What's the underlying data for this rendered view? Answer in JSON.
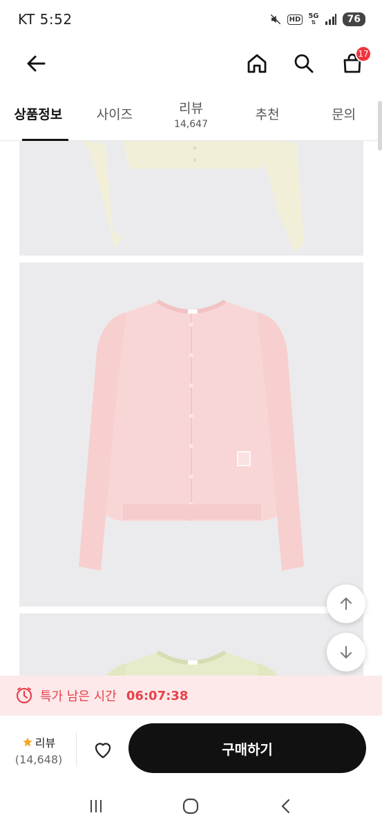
{
  "status_bar": {
    "time": "KT 5:52",
    "hd": "HD",
    "network": "5G",
    "battery": "76"
  },
  "app_bar": {
    "icons": [
      "back-arrow-icon",
      "home-icon",
      "search-icon",
      "shopping-bag-icon"
    ],
    "cart_count": "17"
  },
  "tabs": [
    {
      "label": "상품정보",
      "count": "",
      "active": true
    },
    {
      "label": "사이즈",
      "count": ""
    },
    {
      "label": "리뷰",
      "count": "14,647"
    },
    {
      "label": "추천",
      "count": ""
    },
    {
      "label": "문의",
      "count": ""
    }
  ],
  "product_images": [
    {
      "description": "cream-cardigan",
      "color": "#f2efd9"
    },
    {
      "description": "pink-cardigan",
      "color": "#f9d6d6"
    },
    {
      "description": "mint-cardigan",
      "color": "#e6ecca"
    }
  ],
  "timer": {
    "label": "특가 남은 시간",
    "value": "06:07:38",
    "color": "#e8404a"
  },
  "bottom_bar": {
    "review_label": "리뷰",
    "review_count": "(14,648)",
    "buy_label": "구매하기"
  },
  "colors": {
    "accent_red": "#f0343c",
    "buy_button": "#111111",
    "timer_bg": "#fde9ea"
  }
}
